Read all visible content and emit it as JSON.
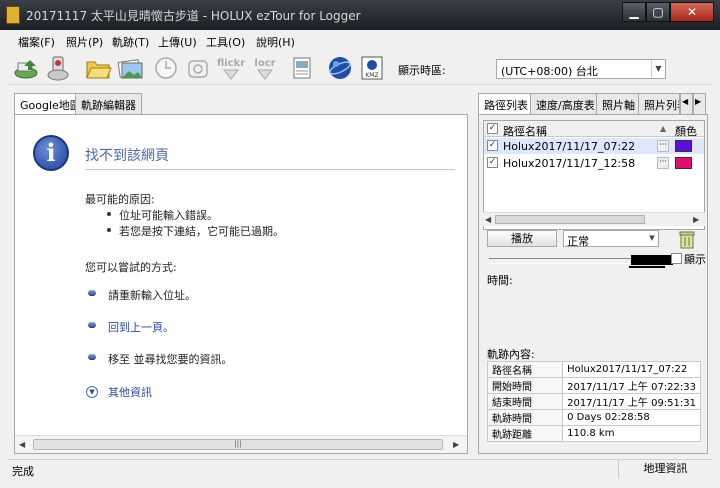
{
  "window": {
    "title": "20171117 太平山見晴懷古步道 - HOLUX ezTour for Logger",
    "min": "▁",
    "max": "▢",
    "close": "✕"
  },
  "menu": [
    {
      "label": "檔案(F)"
    },
    {
      "label": "照片(P)"
    },
    {
      "label": "軌跡(T)"
    },
    {
      "label": "上傳(U)"
    },
    {
      "label": "工具(O)"
    },
    {
      "label": "說明(H)"
    }
  ],
  "toolbar": {
    "icons": [
      "import-device-icon",
      "logger-icon",
      "open-folder-icon",
      "photos-icon",
      "clock-icon",
      "camera-icon",
      "flickr-icon",
      "locr-icon",
      "report-icon",
      "google-earth-icon",
      "kmz-icon"
    ],
    "flickr_text": "flickr",
    "locr_text": "locr",
    "kmz_text": "KMZ",
    "timezone_label": "顯示時區:",
    "timezone_value": "(UTC+08:00) 台北"
  },
  "left_tabs": [
    {
      "label": "Google地圖",
      "active": true
    },
    {
      "label": "軌跡編輯器",
      "active": false
    }
  ],
  "browser": {
    "error_title": "找不到該網頁",
    "causes_heading": "最可能的原因:",
    "causes": [
      "位址可能輸入錯誤。",
      "若您是按下連結，它可能已過期。"
    ],
    "try_heading": "您可以嘗試的方式:",
    "options": [
      {
        "text": "請重新輸入位址。",
        "link": false
      },
      {
        "text": "回到上一頁。",
        "link": true
      },
      {
        "text": "移至 並尋找您要的資訊。",
        "link": false
      }
    ],
    "more_info": "其他資訊",
    "scroll_grip": "|||"
  },
  "right_tabs": [
    {
      "label": "路徑列表",
      "active": true
    },
    {
      "label": "速度/高度表"
    },
    {
      "label": "照片軸"
    },
    {
      "label": "照片列表"
    }
  ],
  "tab_scroll": {
    "left": "◀",
    "right": "▶"
  },
  "track_list": {
    "col_name": "路徑名稱",
    "col_color": "顏色",
    "rows": [
      {
        "name": "Holux2017/11/17_07:22",
        "checked": "✓",
        "color": "#5b10e0"
      },
      {
        "name": "Holux2017/11/17_12:58",
        "checked": "✓",
        "color": "#e0106e"
      }
    ],
    "ellipsis": "···"
  },
  "playback": {
    "play_label": "播放",
    "speed_value": "正常",
    "show_label": "顯示",
    "time_label": "時間:"
  },
  "details": {
    "heading": "軌跡內容:",
    "rows": [
      {
        "k": "路徑名稱",
        "v": "Holux2017/11/17_07:22"
      },
      {
        "k": "開始時間",
        "v": "2017/11/17 上午 07:22:33"
      },
      {
        "k": "結束時間",
        "v": "2017/11/17 上午 09:51:31"
      },
      {
        "k": "軌跡時間",
        "v": "0 Days  02:28:58"
      },
      {
        "k": "軌跡距離",
        "v": "110.8 km"
      }
    ]
  },
  "status": {
    "left": "完成",
    "right": "地理資訊"
  }
}
